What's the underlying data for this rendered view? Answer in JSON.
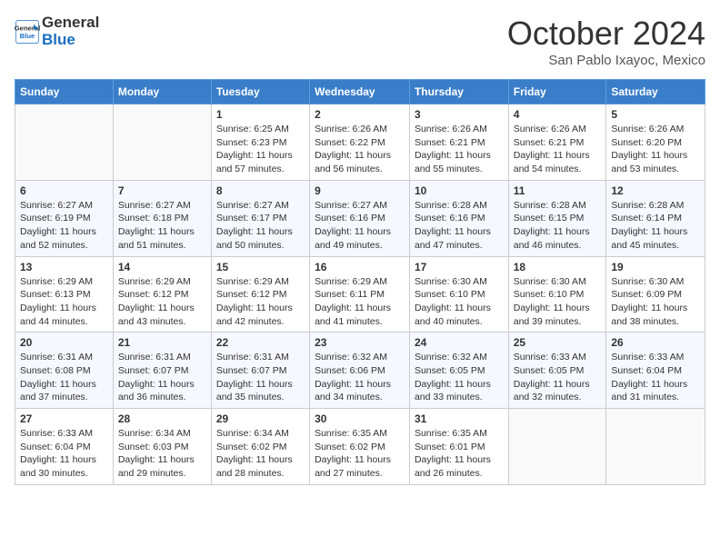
{
  "header": {
    "logo_line1": "General",
    "logo_line2": "Blue",
    "month": "October 2024",
    "location": "San Pablo Ixayoc, Mexico"
  },
  "days_of_week": [
    "Sunday",
    "Monday",
    "Tuesday",
    "Wednesday",
    "Thursday",
    "Friday",
    "Saturday"
  ],
  "weeks": [
    [
      {
        "day": "",
        "info": ""
      },
      {
        "day": "",
        "info": ""
      },
      {
        "day": "1",
        "info": "Sunrise: 6:25 AM\nSunset: 6:23 PM\nDaylight: 11 hours and 57 minutes."
      },
      {
        "day": "2",
        "info": "Sunrise: 6:26 AM\nSunset: 6:22 PM\nDaylight: 11 hours and 56 minutes."
      },
      {
        "day": "3",
        "info": "Sunrise: 6:26 AM\nSunset: 6:21 PM\nDaylight: 11 hours and 55 minutes."
      },
      {
        "day": "4",
        "info": "Sunrise: 6:26 AM\nSunset: 6:21 PM\nDaylight: 11 hours and 54 minutes."
      },
      {
        "day": "5",
        "info": "Sunrise: 6:26 AM\nSunset: 6:20 PM\nDaylight: 11 hours and 53 minutes."
      }
    ],
    [
      {
        "day": "6",
        "info": "Sunrise: 6:27 AM\nSunset: 6:19 PM\nDaylight: 11 hours and 52 minutes."
      },
      {
        "day": "7",
        "info": "Sunrise: 6:27 AM\nSunset: 6:18 PM\nDaylight: 11 hours and 51 minutes."
      },
      {
        "day": "8",
        "info": "Sunrise: 6:27 AM\nSunset: 6:17 PM\nDaylight: 11 hours and 50 minutes."
      },
      {
        "day": "9",
        "info": "Sunrise: 6:27 AM\nSunset: 6:16 PM\nDaylight: 11 hours and 49 minutes."
      },
      {
        "day": "10",
        "info": "Sunrise: 6:28 AM\nSunset: 6:16 PM\nDaylight: 11 hours and 47 minutes."
      },
      {
        "day": "11",
        "info": "Sunrise: 6:28 AM\nSunset: 6:15 PM\nDaylight: 11 hours and 46 minutes."
      },
      {
        "day": "12",
        "info": "Sunrise: 6:28 AM\nSunset: 6:14 PM\nDaylight: 11 hours and 45 minutes."
      }
    ],
    [
      {
        "day": "13",
        "info": "Sunrise: 6:29 AM\nSunset: 6:13 PM\nDaylight: 11 hours and 44 minutes."
      },
      {
        "day": "14",
        "info": "Sunrise: 6:29 AM\nSunset: 6:12 PM\nDaylight: 11 hours and 43 minutes."
      },
      {
        "day": "15",
        "info": "Sunrise: 6:29 AM\nSunset: 6:12 PM\nDaylight: 11 hours and 42 minutes."
      },
      {
        "day": "16",
        "info": "Sunrise: 6:29 AM\nSunset: 6:11 PM\nDaylight: 11 hours and 41 minutes."
      },
      {
        "day": "17",
        "info": "Sunrise: 6:30 AM\nSunset: 6:10 PM\nDaylight: 11 hours and 40 minutes."
      },
      {
        "day": "18",
        "info": "Sunrise: 6:30 AM\nSunset: 6:10 PM\nDaylight: 11 hours and 39 minutes."
      },
      {
        "day": "19",
        "info": "Sunrise: 6:30 AM\nSunset: 6:09 PM\nDaylight: 11 hours and 38 minutes."
      }
    ],
    [
      {
        "day": "20",
        "info": "Sunrise: 6:31 AM\nSunset: 6:08 PM\nDaylight: 11 hours and 37 minutes."
      },
      {
        "day": "21",
        "info": "Sunrise: 6:31 AM\nSunset: 6:07 PM\nDaylight: 11 hours and 36 minutes."
      },
      {
        "day": "22",
        "info": "Sunrise: 6:31 AM\nSunset: 6:07 PM\nDaylight: 11 hours and 35 minutes."
      },
      {
        "day": "23",
        "info": "Sunrise: 6:32 AM\nSunset: 6:06 PM\nDaylight: 11 hours and 34 minutes."
      },
      {
        "day": "24",
        "info": "Sunrise: 6:32 AM\nSunset: 6:05 PM\nDaylight: 11 hours and 33 minutes."
      },
      {
        "day": "25",
        "info": "Sunrise: 6:33 AM\nSunset: 6:05 PM\nDaylight: 11 hours and 32 minutes."
      },
      {
        "day": "26",
        "info": "Sunrise: 6:33 AM\nSunset: 6:04 PM\nDaylight: 11 hours and 31 minutes."
      }
    ],
    [
      {
        "day": "27",
        "info": "Sunrise: 6:33 AM\nSunset: 6:04 PM\nDaylight: 11 hours and 30 minutes."
      },
      {
        "day": "28",
        "info": "Sunrise: 6:34 AM\nSunset: 6:03 PM\nDaylight: 11 hours and 29 minutes."
      },
      {
        "day": "29",
        "info": "Sunrise: 6:34 AM\nSunset: 6:02 PM\nDaylight: 11 hours and 28 minutes."
      },
      {
        "day": "30",
        "info": "Sunrise: 6:35 AM\nSunset: 6:02 PM\nDaylight: 11 hours and 27 minutes."
      },
      {
        "day": "31",
        "info": "Sunrise: 6:35 AM\nSunset: 6:01 PM\nDaylight: 11 hours and 26 minutes."
      },
      {
        "day": "",
        "info": ""
      },
      {
        "day": "",
        "info": ""
      }
    ]
  ]
}
